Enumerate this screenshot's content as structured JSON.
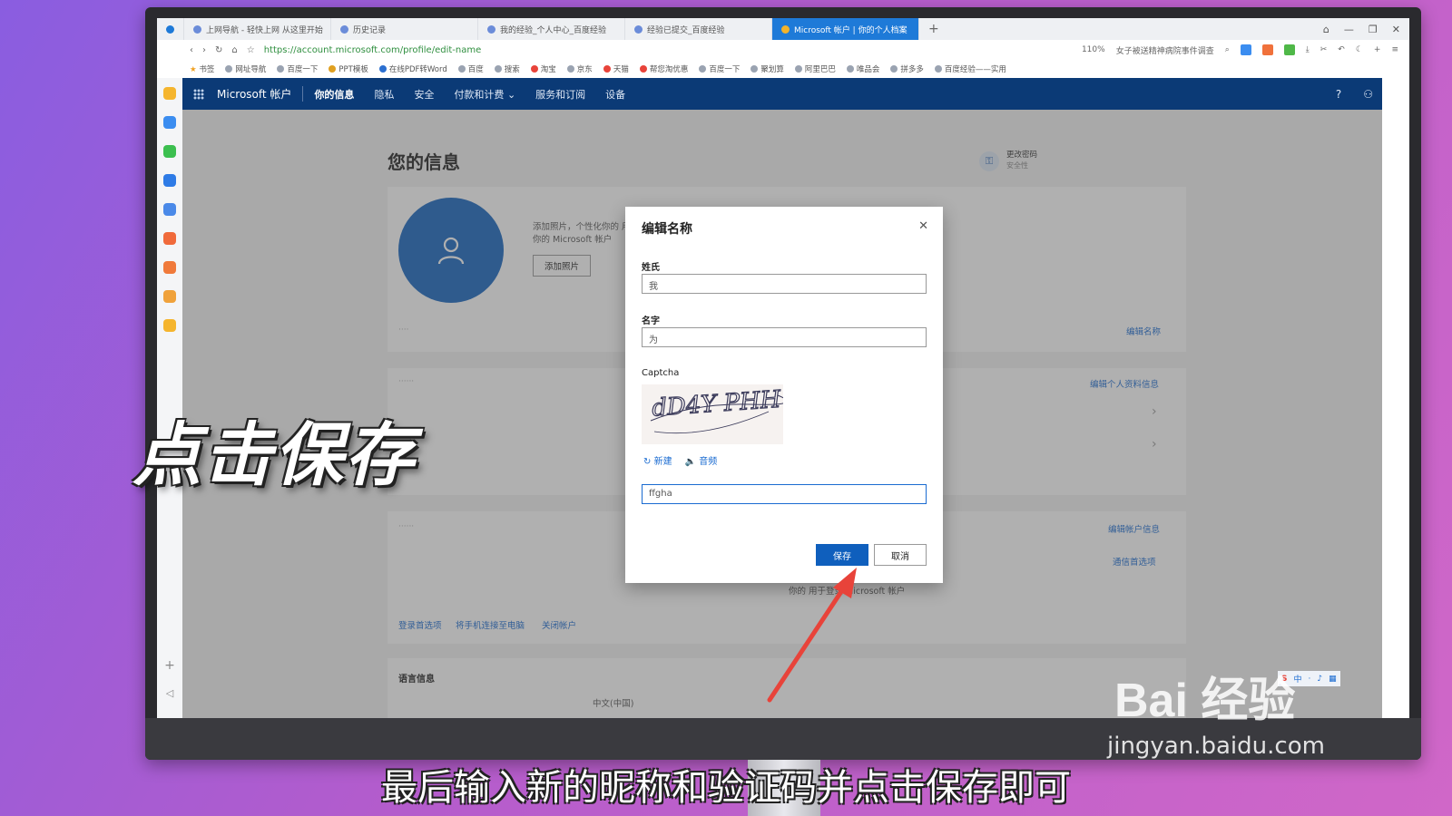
{
  "browser": {
    "tabs": [
      {
        "label": "上网导航 - 轻快上网 从这里开始",
        "active": false
      },
      {
        "label": "历史记录",
        "active": false
      },
      {
        "label": "我的经验_个人中心_百度经验",
        "active": false
      },
      {
        "label": "经验已提交_百度经验",
        "active": false
      },
      {
        "label": "Microsoft 帐户 | 你的个人档案",
        "active": true
      }
    ],
    "new_tab": "+",
    "url": "https://account.microsoft.com/profile/edit-name",
    "zoom": "110%",
    "news_ticker": "女子被送精神病院事件调查",
    "bookmarks": [
      "书签",
      "网址导航",
      "百度一下",
      "PPT模板",
      "在线PDF转Word",
      "百度",
      "搜索",
      "淘宝",
      "京东",
      "天猫",
      "帮您淘优惠",
      "百度一下",
      "聚划算",
      "阿里巴巴",
      "唯品会",
      "拼多多",
      "百度经验——实用"
    ]
  },
  "ms_nav": {
    "brand": "Microsoft 帐户",
    "items": [
      "你的信息",
      "隐私",
      "安全",
      "付款和计费",
      "服务和订阅",
      "设备"
    ],
    "active_index": 0,
    "help": "?"
  },
  "page": {
    "title": "您的信息",
    "change_password": "更改密码",
    "change_password_sub": "安全性",
    "photo_text": "添加照片，个性化你的 用你的 Microsoft 帐户",
    "add_photo": "添加照片",
    "edit_name": "编辑名称",
    "edit_profile": "编辑个人资料信息",
    "edit_account": "编辑帐户信息",
    "comm_prefs": "通信首选项",
    "signin_note": "你的    用于登录 Microsoft 帐户",
    "bottom_links": [
      "登录首选项",
      "将手机连接至电脑",
      "关闭帐户"
    ],
    "lang_heading": "语言信息",
    "lang_value": "中文(中国)"
  },
  "dialog": {
    "title": "编辑名称",
    "surname_label": "姓氏",
    "surname_value": "我",
    "given_label": "名字",
    "given_value": "为",
    "captcha_label": "Captcha",
    "captcha_text": "dD4Y PHH",
    "new_link": "新建",
    "audio_link": "音频",
    "captcha_input": "ffgha",
    "save": "保存",
    "cancel": "取消"
  },
  "overlay": {
    "big_caption": "点击保存",
    "subtitle": "最后输入新的昵称和验证码并点击保存即可",
    "watermark_main": "Bai 经验",
    "watermark_url": "jingyan.baidu.com"
  },
  "colors": {
    "ms_blue": "#0b3a76",
    "primary_button": "#0f5fbd",
    "link": "#1a6bd1",
    "arrow": "#e8433a"
  }
}
